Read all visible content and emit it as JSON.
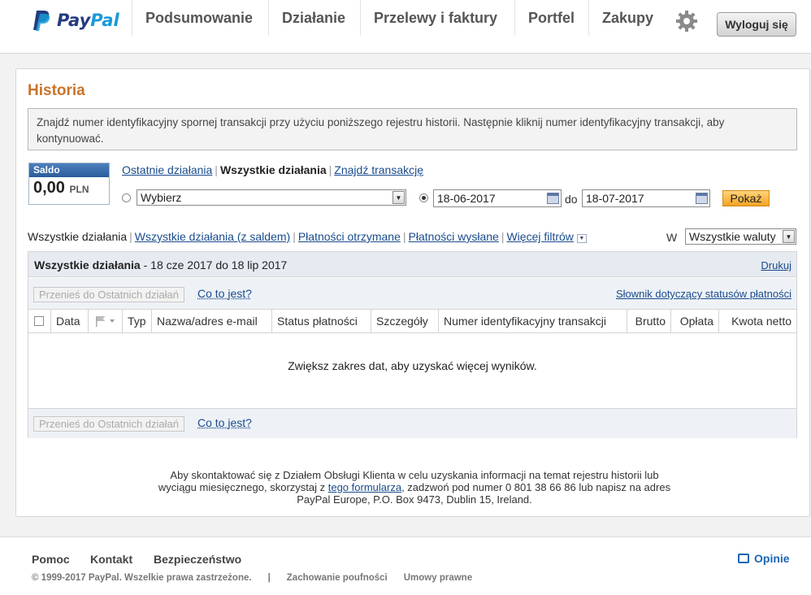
{
  "header": {
    "logo_text_1": "Pay",
    "logo_text_2": "Pal",
    "nav": [
      "Podsumowanie",
      "Działanie",
      "Przelewy i faktury",
      "Portfel",
      "Zakupy"
    ],
    "logout_label": "Wyloguj się",
    "settings_icon": "gear-icon"
  },
  "history": {
    "title": "Historia",
    "info": "Znajdź numer identyfikacyjny spornej transakcji przy użyciu poniższego rejestru historii. Następnie kliknij numer identyfikacyjny transakcji, aby kontynuować.",
    "balance_label": "Saldo",
    "balance_value": "0,00",
    "balance_currency": "PLN",
    "tabs": {
      "recent": "Ostatnie działania",
      "all": "Wszystkie działania",
      "find": "Znajdź transakcję"
    },
    "period_select": "Wybierz",
    "date_from": "18-06-2017",
    "date_to_label": "do",
    "date_to": "18-07-2017",
    "show_label": "Pokaż",
    "filters": {
      "all": "Wszystkie działania",
      "all_balance": "Wszystkie działania (z saldem)",
      "received": "Płatności otrzymane",
      "sent": "Płatności wysłane",
      "more": "Więcej filtrów"
    },
    "currency_label": "W",
    "currency_select": "Wszystkie waluty"
  },
  "grid": {
    "heading": "Wszystkie działania",
    "range": "- 18 cze 2017 do 18 lip 2017",
    "print": "Drukuj",
    "move_button": "Przenieś do Ostatnich działań",
    "what_is_it": "Co to jest?",
    "status_dictionary": "Słownik dotyczący statusów płatności",
    "columns": {
      "date": "Data",
      "type": "Typ",
      "name": "Nazwa/adres e-mail",
      "status": "Status płatności",
      "details": "Szczegóły",
      "txn_id": "Numer identyfikacyjny transakcji",
      "gross": "Brutto",
      "fee": "Opłata",
      "net": "Kwota netto"
    },
    "empty_message": "Zwiększ zakres dat, aby uzyskać więcej wyników."
  },
  "contact": {
    "text_1": "Aby skontaktować się z Działem Obsługi Klienta w celu uzyskania informacji na temat rejestru historii lub wyciągu miesięcznego, skorzystaj z ",
    "link": "tego formularza",
    "text_2": ", zadzwoń pod numer 0 801 38 66 86 lub napisz na adres PayPal Europe, P.O. Box 9473, Dublin 15, Ireland."
  },
  "footer": {
    "help": "Pomoc",
    "contact": "Kontakt",
    "security": "Bezpieczeństwo",
    "copyright": "© 1999-2017 PayPal. Wszelkie prawa zastrzeżone.",
    "divider": "|",
    "privacy": "Zachowanie poufności",
    "legal": "Umowy prawne",
    "feedback": "Opinie"
  }
}
